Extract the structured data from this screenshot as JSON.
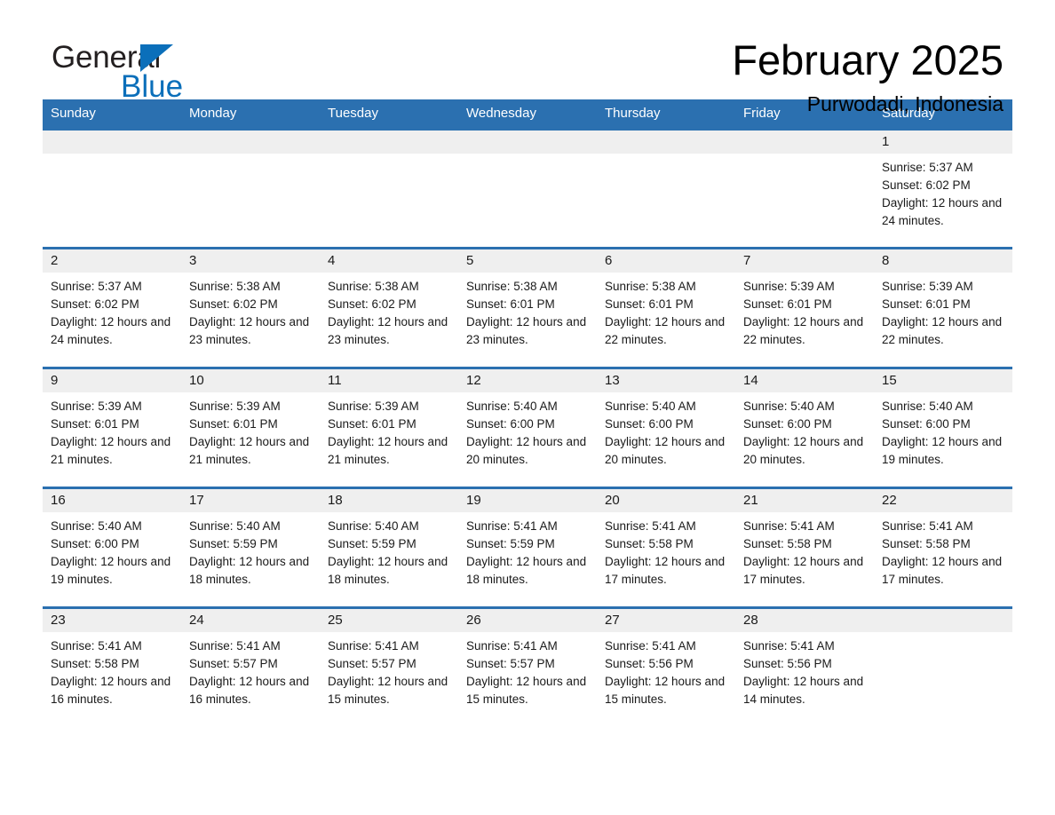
{
  "brand": {
    "name_part1": "General",
    "name_part2": "Blue",
    "accent_color": "#0b6fba"
  },
  "header": {
    "title": "February 2025",
    "location": "Purwodadi, Indonesia"
  },
  "colors": {
    "header_bar": "#2b70b0",
    "day_band": "#efefef",
    "text": "#1a1a1a"
  },
  "weekdays": [
    "Sunday",
    "Monday",
    "Tuesday",
    "Wednesday",
    "Thursday",
    "Friday",
    "Saturday"
  ],
  "weeks": [
    [
      {
        "day": "",
        "sunrise": "",
        "sunset": "",
        "daylight": "",
        "empty": true
      },
      {
        "day": "",
        "sunrise": "",
        "sunset": "",
        "daylight": "",
        "empty": true
      },
      {
        "day": "",
        "sunrise": "",
        "sunset": "",
        "daylight": "",
        "empty": true
      },
      {
        "day": "",
        "sunrise": "",
        "sunset": "",
        "daylight": "",
        "empty": true
      },
      {
        "day": "",
        "sunrise": "",
        "sunset": "",
        "daylight": "",
        "empty": true
      },
      {
        "day": "",
        "sunrise": "",
        "sunset": "",
        "daylight": "",
        "empty": true
      },
      {
        "day": "1",
        "sunrise": "Sunrise: 5:37 AM",
        "sunset": "Sunset: 6:02 PM",
        "daylight": "Daylight: 12 hours and 24 minutes.",
        "empty": false
      }
    ],
    [
      {
        "day": "2",
        "sunrise": "Sunrise: 5:37 AM",
        "sunset": "Sunset: 6:02 PM",
        "daylight": "Daylight: 12 hours and 24 minutes.",
        "empty": false
      },
      {
        "day": "3",
        "sunrise": "Sunrise: 5:38 AM",
        "sunset": "Sunset: 6:02 PM",
        "daylight": "Daylight: 12 hours and 23 minutes.",
        "empty": false
      },
      {
        "day": "4",
        "sunrise": "Sunrise: 5:38 AM",
        "sunset": "Sunset: 6:02 PM",
        "daylight": "Daylight: 12 hours and 23 minutes.",
        "empty": false
      },
      {
        "day": "5",
        "sunrise": "Sunrise: 5:38 AM",
        "sunset": "Sunset: 6:01 PM",
        "daylight": "Daylight: 12 hours and 23 minutes.",
        "empty": false
      },
      {
        "day": "6",
        "sunrise": "Sunrise: 5:38 AM",
        "sunset": "Sunset: 6:01 PM",
        "daylight": "Daylight: 12 hours and 22 minutes.",
        "empty": false
      },
      {
        "day": "7",
        "sunrise": "Sunrise: 5:39 AM",
        "sunset": "Sunset: 6:01 PM",
        "daylight": "Daylight: 12 hours and 22 minutes.",
        "empty": false
      },
      {
        "day": "8",
        "sunrise": "Sunrise: 5:39 AM",
        "sunset": "Sunset: 6:01 PM",
        "daylight": "Daylight: 12 hours and 22 minutes.",
        "empty": false
      }
    ],
    [
      {
        "day": "9",
        "sunrise": "Sunrise: 5:39 AM",
        "sunset": "Sunset: 6:01 PM",
        "daylight": "Daylight: 12 hours and 21 minutes.",
        "empty": false
      },
      {
        "day": "10",
        "sunrise": "Sunrise: 5:39 AM",
        "sunset": "Sunset: 6:01 PM",
        "daylight": "Daylight: 12 hours and 21 minutes.",
        "empty": false
      },
      {
        "day": "11",
        "sunrise": "Sunrise: 5:39 AM",
        "sunset": "Sunset: 6:01 PM",
        "daylight": "Daylight: 12 hours and 21 minutes.",
        "empty": false
      },
      {
        "day": "12",
        "sunrise": "Sunrise: 5:40 AM",
        "sunset": "Sunset: 6:00 PM",
        "daylight": "Daylight: 12 hours and 20 minutes.",
        "empty": false
      },
      {
        "day": "13",
        "sunrise": "Sunrise: 5:40 AM",
        "sunset": "Sunset: 6:00 PM",
        "daylight": "Daylight: 12 hours and 20 minutes.",
        "empty": false
      },
      {
        "day": "14",
        "sunrise": "Sunrise: 5:40 AM",
        "sunset": "Sunset: 6:00 PM",
        "daylight": "Daylight: 12 hours and 20 minutes.",
        "empty": false
      },
      {
        "day": "15",
        "sunrise": "Sunrise: 5:40 AM",
        "sunset": "Sunset: 6:00 PM",
        "daylight": "Daylight: 12 hours and 19 minutes.",
        "empty": false
      }
    ],
    [
      {
        "day": "16",
        "sunrise": "Sunrise: 5:40 AM",
        "sunset": "Sunset: 6:00 PM",
        "daylight": "Daylight: 12 hours and 19 minutes.",
        "empty": false
      },
      {
        "day": "17",
        "sunrise": "Sunrise: 5:40 AM",
        "sunset": "Sunset: 5:59 PM",
        "daylight": "Daylight: 12 hours and 18 minutes.",
        "empty": false
      },
      {
        "day": "18",
        "sunrise": "Sunrise: 5:40 AM",
        "sunset": "Sunset: 5:59 PM",
        "daylight": "Daylight: 12 hours and 18 minutes.",
        "empty": false
      },
      {
        "day": "19",
        "sunrise": "Sunrise: 5:41 AM",
        "sunset": "Sunset: 5:59 PM",
        "daylight": "Daylight: 12 hours and 18 minutes.",
        "empty": false
      },
      {
        "day": "20",
        "sunrise": "Sunrise: 5:41 AM",
        "sunset": "Sunset: 5:58 PM",
        "daylight": "Daylight: 12 hours and 17 minutes.",
        "empty": false
      },
      {
        "day": "21",
        "sunrise": "Sunrise: 5:41 AM",
        "sunset": "Sunset: 5:58 PM",
        "daylight": "Daylight: 12 hours and 17 minutes.",
        "empty": false
      },
      {
        "day": "22",
        "sunrise": "Sunrise: 5:41 AM",
        "sunset": "Sunset: 5:58 PM",
        "daylight": "Daylight: 12 hours and 17 minutes.",
        "empty": false
      }
    ],
    [
      {
        "day": "23",
        "sunrise": "Sunrise: 5:41 AM",
        "sunset": "Sunset: 5:58 PM",
        "daylight": "Daylight: 12 hours and 16 minutes.",
        "empty": false
      },
      {
        "day": "24",
        "sunrise": "Sunrise: 5:41 AM",
        "sunset": "Sunset: 5:57 PM",
        "daylight": "Daylight: 12 hours and 16 minutes.",
        "empty": false
      },
      {
        "day": "25",
        "sunrise": "Sunrise: 5:41 AM",
        "sunset": "Sunset: 5:57 PM",
        "daylight": "Daylight: 12 hours and 15 minutes.",
        "empty": false
      },
      {
        "day": "26",
        "sunrise": "Sunrise: 5:41 AM",
        "sunset": "Sunset: 5:57 PM",
        "daylight": "Daylight: 12 hours and 15 minutes.",
        "empty": false
      },
      {
        "day": "27",
        "sunrise": "Sunrise: 5:41 AM",
        "sunset": "Sunset: 5:56 PM",
        "daylight": "Daylight: 12 hours and 15 minutes.",
        "empty": false
      },
      {
        "day": "28",
        "sunrise": "Sunrise: 5:41 AM",
        "sunset": "Sunset: 5:56 PM",
        "daylight": "Daylight: 12 hours and 14 minutes.",
        "empty": false
      },
      {
        "day": "",
        "sunrise": "",
        "sunset": "",
        "daylight": "",
        "empty": true
      }
    ]
  ]
}
